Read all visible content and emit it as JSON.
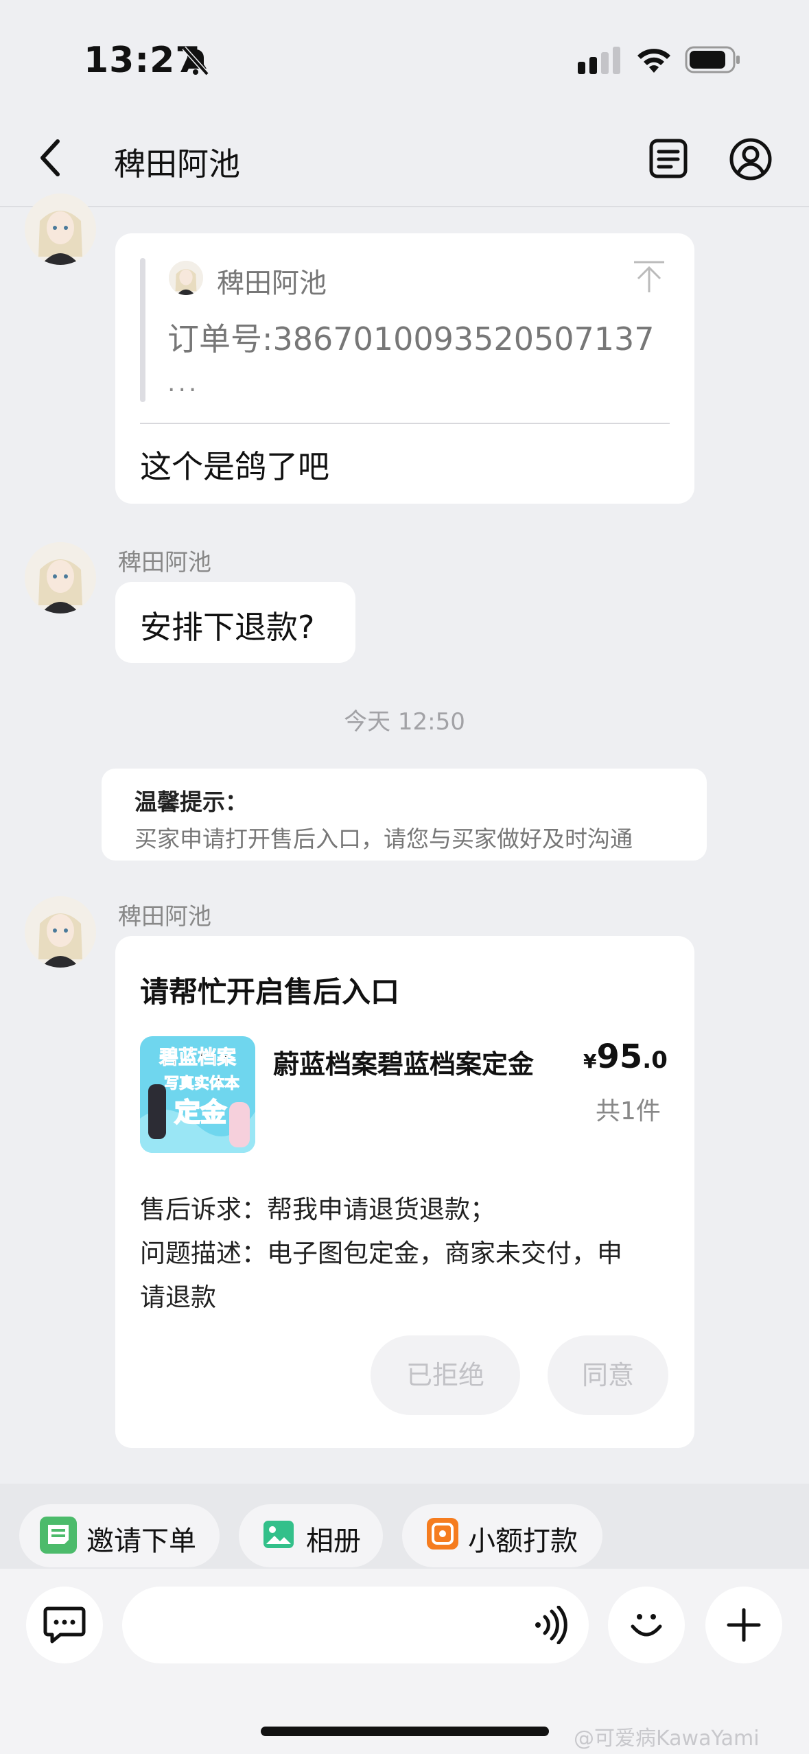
{
  "status_bar": {
    "time": "13:27"
  },
  "nav": {
    "title": "稗田阿池"
  },
  "messages": [
    {
      "sender": "稗田阿池",
      "quote": {
        "name": "稗田阿池",
        "text": "订单号:3867010093520507137",
        "ellipsis": "..."
      },
      "text": "这个是鸽了吧"
    },
    {
      "sender": "稗田阿池",
      "text": "安排下退款?"
    }
  ],
  "time_separator": "今天 12:50",
  "notice": {
    "title": "温馨提示：",
    "body": "买家申请打开售后入口，请您与买家做好及时沟通"
  },
  "after_sale": {
    "sender": "稗田阿池",
    "title": "请帮忙开启售后入口",
    "product": {
      "name": "蔚蓝档案碧蓝档案定金",
      "currency": "¥",
      "price_int": "95",
      "price_dec": ".0",
      "qty": "共1件",
      "image_text_1": "碧蓝档案",
      "image_text_2": "写真实体本",
      "image_text_3": "定金"
    },
    "request_line": "售后诉求：帮我申请退货退款；",
    "desc_line_1": "问题描述：电子图包定金，商家未交付，申",
    "desc_line_2": "请退款",
    "reject_label": "已拒绝",
    "agree_label": "同意"
  },
  "quick_actions": [
    {
      "label": "邀请下单",
      "icon": "invite-order-icon",
      "color": "#4cbb6b"
    },
    {
      "label": "相册",
      "icon": "album-icon",
      "color": "#33c08a"
    },
    {
      "label": "小额打款",
      "icon": "payment-icon",
      "color": "#f57c1f"
    }
  ],
  "input": {
    "placeholder": ""
  },
  "watermark": "@可爱病KawaYami"
}
